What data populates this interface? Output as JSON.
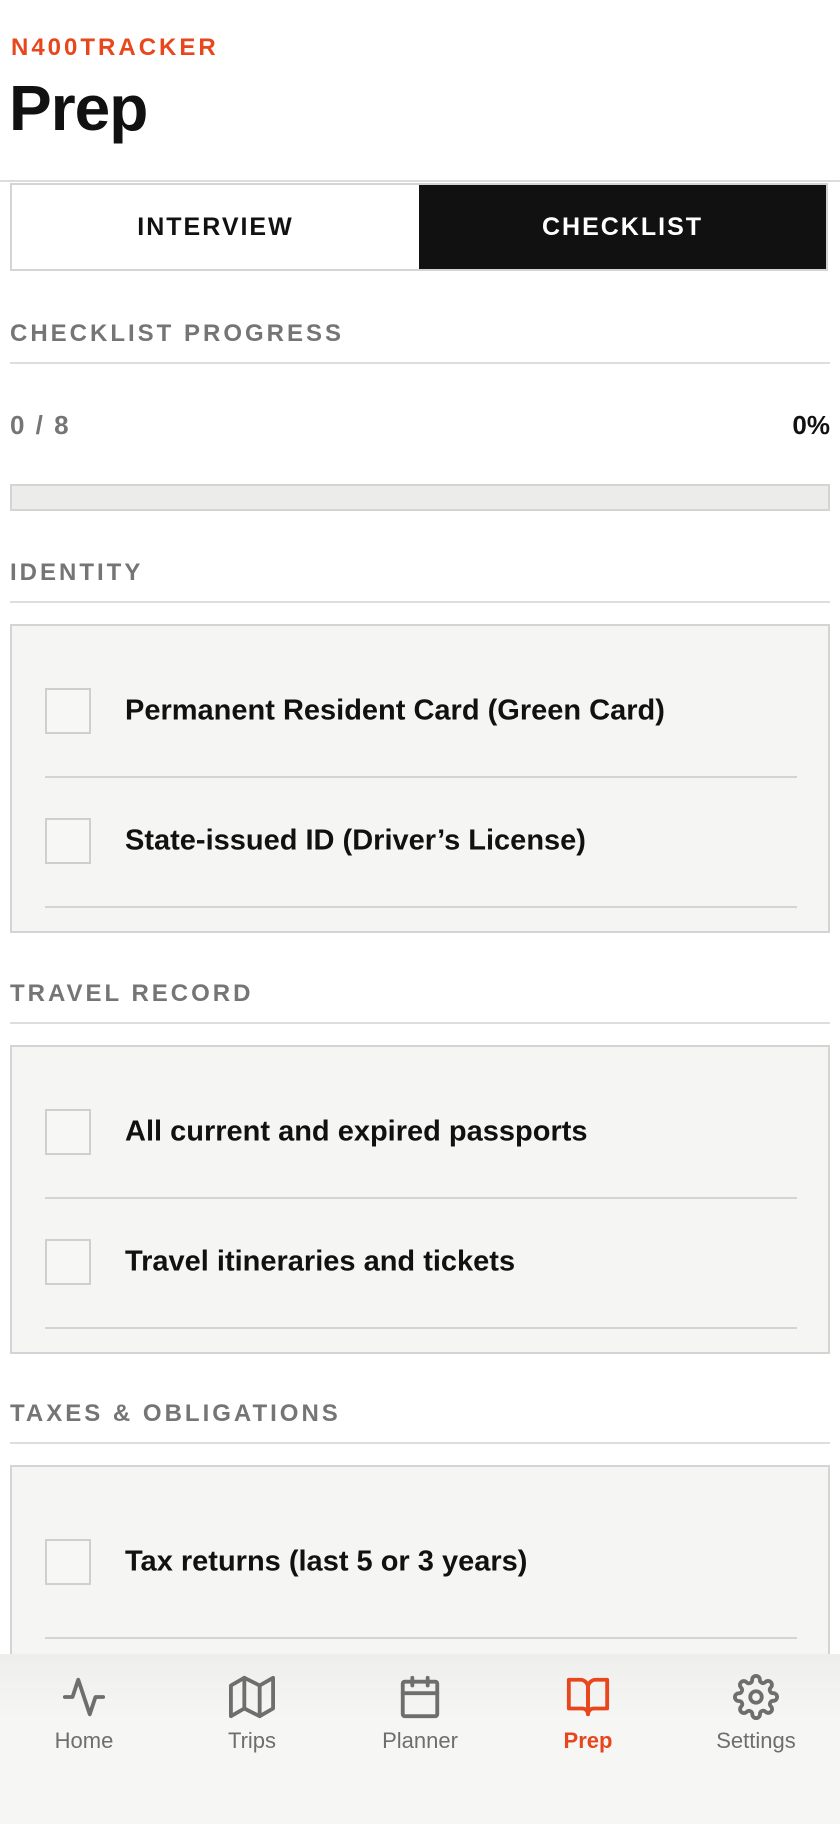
{
  "header": {
    "brand": "N400TRACKER",
    "title": "Prep"
  },
  "segmented": {
    "options": [
      "INTERVIEW",
      "CHECKLIST"
    ],
    "selected": "CHECKLIST"
  },
  "progress": {
    "section_title": "CHECKLIST PROGRESS",
    "count_text": "0 / 8",
    "percent_text": "0%",
    "fraction": 0
  },
  "sections": [
    {
      "title": "IDENTITY",
      "items": [
        {
          "label": "Permanent Resident Card (Green Card)",
          "checked": false
        },
        {
          "label": "State-issued ID (Driver’s License)",
          "checked": false
        }
      ]
    },
    {
      "title": "TRAVEL RECORD",
      "items": [
        {
          "label": "All current and expired passports",
          "checked": false
        },
        {
          "label": "Travel itineraries and tickets",
          "checked": false
        }
      ]
    },
    {
      "title": "TAXES & OBLIGATIONS",
      "items": [
        {
          "label": "Tax returns (last 5 or 3 years)",
          "checked": false
        }
      ]
    }
  ],
  "tabbar": {
    "items": [
      {
        "label": "Home",
        "icon": "activity-icon"
      },
      {
        "label": "Trips",
        "icon": "map-icon"
      },
      {
        "label": "Planner",
        "icon": "calendar-icon"
      },
      {
        "label": "Prep",
        "icon": "book-icon"
      },
      {
        "label": "Settings",
        "icon": "gear-icon"
      }
    ],
    "active": "Prep"
  },
  "colors": {
    "accent": "#e8461c",
    "dark": "#111111",
    "muted": "#757575",
    "card_bg": "#f5f5f3"
  }
}
